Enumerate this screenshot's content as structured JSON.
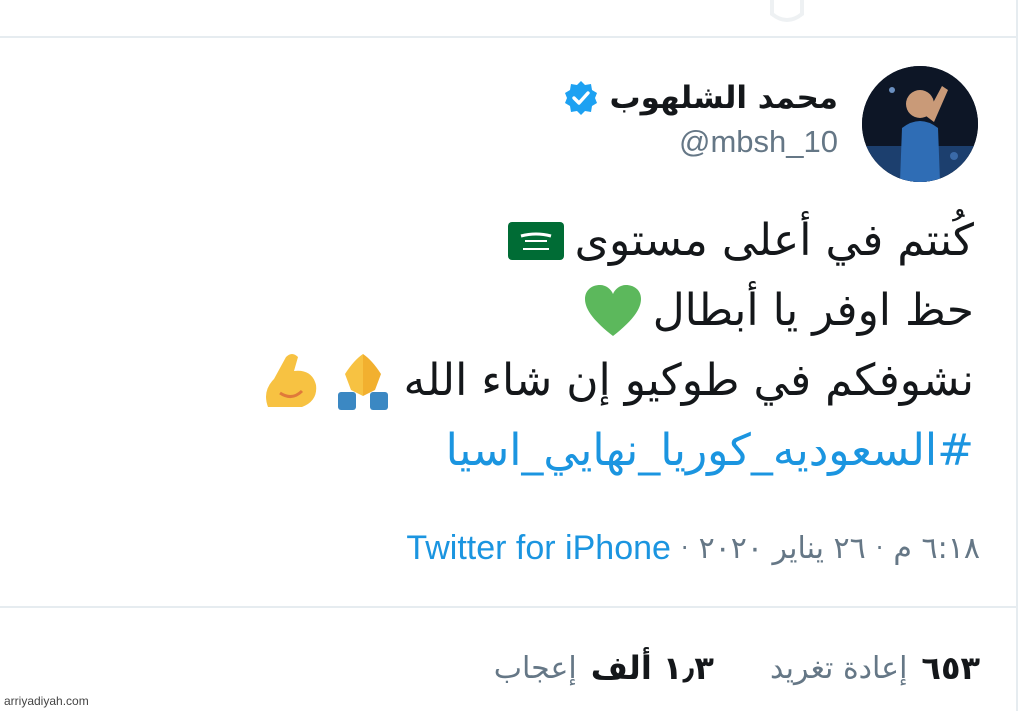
{
  "tweet": {
    "author": {
      "display_name": "محمد الشلهوب",
      "handle": "@mbsh_10",
      "verified_icon": "verified-badge-icon",
      "avatar": "avatar-photo"
    },
    "lines": [
      {
        "text": "كُنتم في أعلى مستوى",
        "emoji": [
          "saudi-flag-emoji"
        ]
      },
      {
        "text": "حظ اوفر يا أبطال",
        "emoji": [
          "green-heart-emoji"
        ]
      },
      {
        "text": "نشوفكم في طوكيو إن شاء الله",
        "emoji": [
          "folded-hands-emoji",
          "flexed-biceps-emoji"
        ]
      }
    ],
    "hashtag": "#السعوديه_كوريا_نهايي_اسيا",
    "meta": {
      "time": "٦:١٨ م",
      "separator": "·",
      "date": "٢٦ يناير ٢٠٢٠",
      "source": "Twitter for iPhone"
    },
    "stats": {
      "retweets_value": "٦٥٣",
      "retweets_label": "إعادة تغريد",
      "likes_value": "١٫٣ ألف",
      "likes_label": "إعجاب"
    }
  },
  "watermark": "arriyadiyah.com",
  "colors": {
    "text": "#14171a",
    "secondary": "#657786",
    "link": "#1b95e0",
    "divider": "#e6ecf0",
    "verified": "#1da1f2",
    "heart": "#5cb85c",
    "flag": "#006c35",
    "emoji_yellow": "#f7c242"
  }
}
